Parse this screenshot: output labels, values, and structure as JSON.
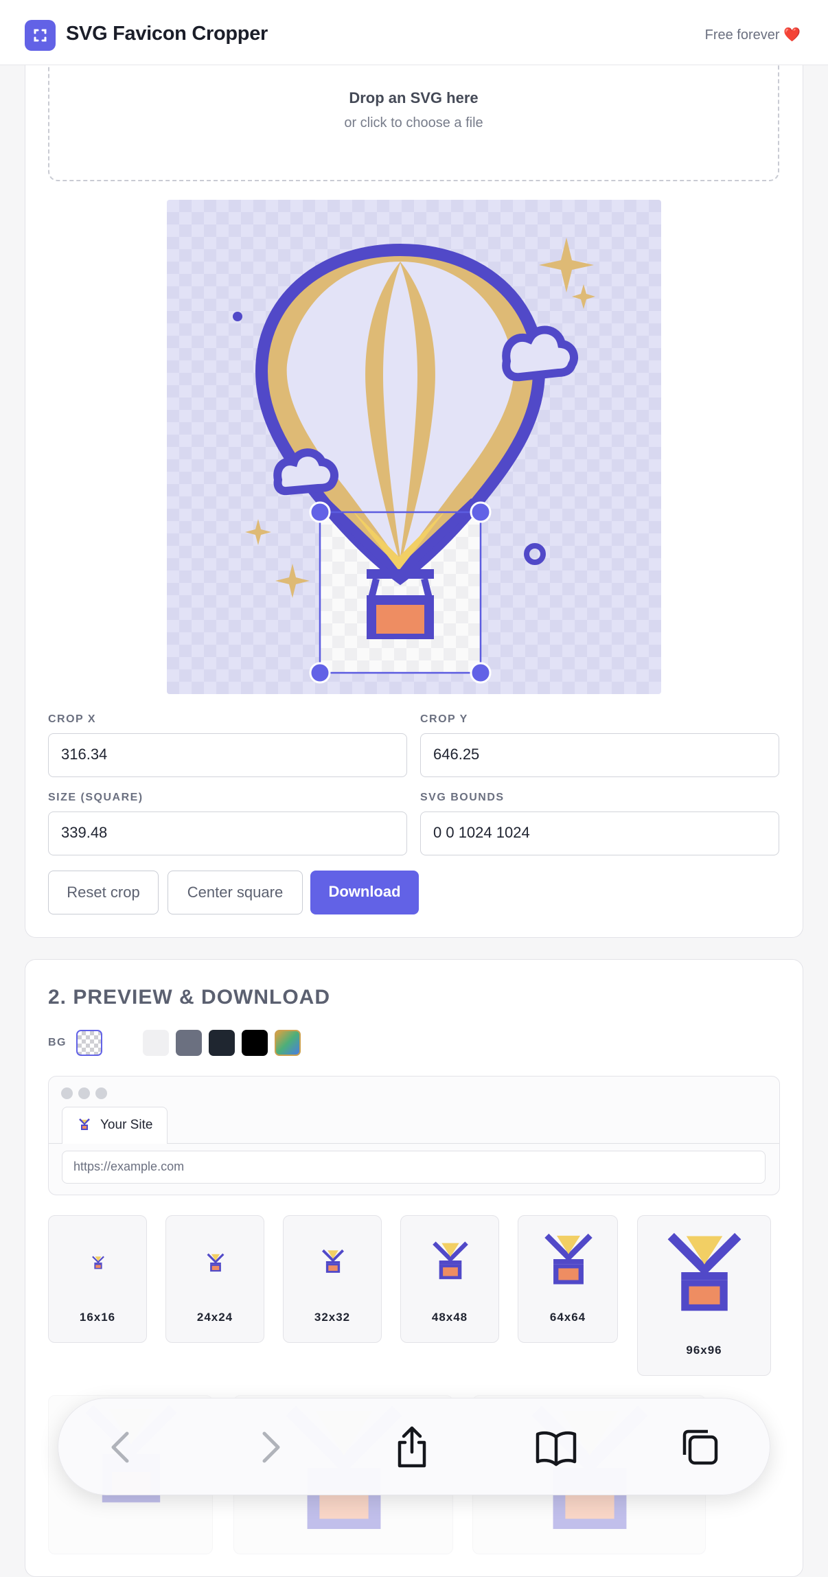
{
  "header": {
    "title": "SVG Favicon Cropper",
    "free_text": "Free forever ❤️",
    "logo_icon": "crop-corners-icon",
    "accent_color": "#6262e6"
  },
  "dropzone": {
    "title": "Drop an SVG here",
    "subtitle": "or click to choose a file"
  },
  "crop_fields": {
    "crop_x_label": "CROP X",
    "crop_x_value": "316.34",
    "crop_y_label": "CROP Y",
    "crop_y_value": "646.25",
    "size_label": "SIZE (SQUARE)",
    "size_value": "339.48",
    "bounds_label": "SVG BOUNDS",
    "bounds_value": "0 0 1024 1024"
  },
  "actions": {
    "reset": "Reset crop",
    "center": "Center square",
    "download": "Download"
  },
  "preview": {
    "section_title": "2. PREVIEW & DOWNLOAD",
    "bg_label": "BG",
    "bg_swatches": [
      "checker",
      "#ffffff",
      "#f2f2f4",
      "#6b7080",
      "#1f2630",
      "#000000",
      "gradient"
    ],
    "browser": {
      "tab_label": "Your Site",
      "url": "https://example.com"
    },
    "sizes": [
      "16x16",
      "24x24",
      "32x32",
      "48x48",
      "64x64",
      "96x96"
    ]
  },
  "dock": {
    "icons": [
      "back-icon",
      "forward-icon",
      "share-icon",
      "bookmarks-icon",
      "tabs-icon"
    ]
  }
}
